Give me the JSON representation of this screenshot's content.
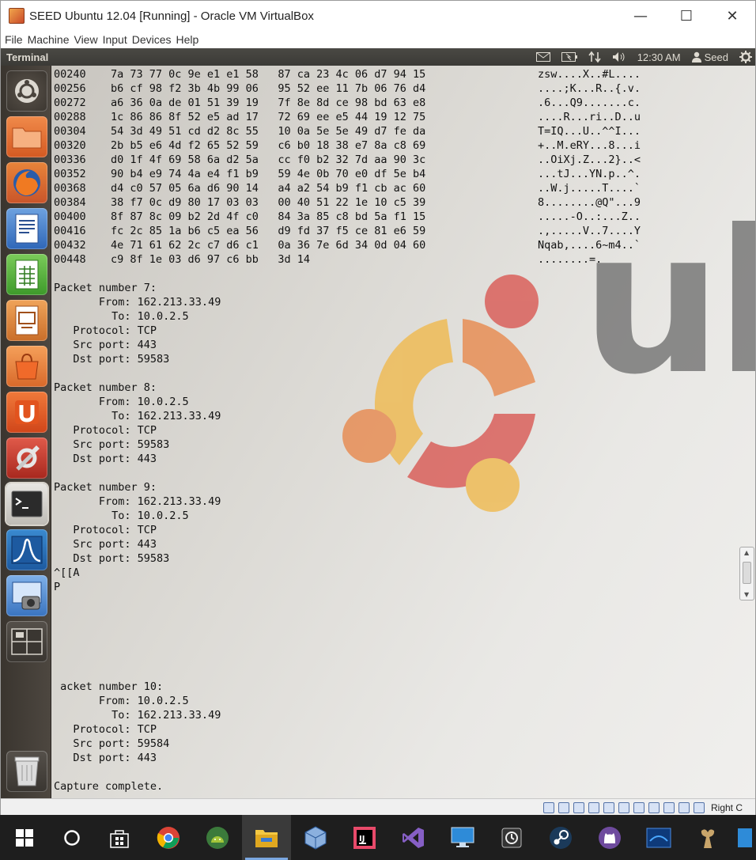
{
  "window": {
    "title": "SEED Ubuntu 12.04 [Running] - Oracle VM VirtualBox",
    "controls": {
      "minimize": "—",
      "maximize": "☐",
      "close": "✕"
    }
  },
  "menubar": {
    "items": [
      "File",
      "Machine",
      "View",
      "Input",
      "Devices",
      "Help"
    ]
  },
  "topbar": {
    "app_title": "Terminal",
    "time": "12:30 AM",
    "user": "Seed",
    "icons": [
      "mail-icon",
      "battery-icon",
      "network-icon",
      "volume-icon",
      "user-icon",
      "gear-icon"
    ]
  },
  "launcher": {
    "items": [
      "ubuntu-dash-icon",
      "files-icon",
      "firefox-icon",
      "writer-icon",
      "calc-icon",
      "impress-icon",
      "software-center-icon",
      "ubuntu-one-icon",
      "system-settings-icon",
      "terminal-icon",
      "wireshark-icon",
      "screenshot-icon",
      "workspace-switcher-icon",
      "trash-icon"
    ]
  },
  "terminal": {
    "hex_rows": [
      {
        "off": "00240",
        "hex": "7a 73 77 0c 9e e1 e1 58   87 ca 23 4c 06 d7 94 15",
        "ascii": "zsw....X..#L...."
      },
      {
        "off": "00256",
        "hex": "b6 cf 98 f2 3b 4b 99 06   95 52 ee 11 7b 06 76 d4",
        "ascii": "....;K...R..{.v."
      },
      {
        "off": "00272",
        "hex": "a6 36 0a de 01 51 39 19   7f 8e 8d ce 98 bd 63 e8",
        "ascii": ".6...Q9.......c."
      },
      {
        "off": "00288",
        "hex": "1c 86 86 8f 52 e5 ad 17   72 69 ee e5 44 19 12 75",
        "ascii": "....R...ri..D..u"
      },
      {
        "off": "00304",
        "hex": "54 3d 49 51 cd d2 8c 55   10 0a 5e 5e 49 d7 fe da",
        "ascii": "T=IQ...U..^^I..."
      },
      {
        "off": "00320",
        "hex": "2b b5 e6 4d f2 65 52 59   c6 b0 18 38 e7 8a c8 69",
        "ascii": "+..M.eRY...8...i"
      },
      {
        "off": "00336",
        "hex": "d0 1f 4f 69 58 6a d2 5a   cc f0 b2 32 7d aa 90 3c",
        "ascii": "..OiXj.Z...2}..<"
      },
      {
        "off": "00352",
        "hex": "90 b4 e9 74 4a e4 f1 b9   59 4e 0b 70 e0 df 5e b4",
        "ascii": "...tJ...YN.p..^."
      },
      {
        "off": "00368",
        "hex": "d4 c0 57 05 6a d6 90 14   a4 a2 54 b9 f1 cb ac 60",
        "ascii": "..W.j.....T....`"
      },
      {
        "off": "00384",
        "hex": "38 f7 0c d9 80 17 03 03   00 40 51 22 1e 10 c5 39",
        "ascii": "8........@Q\"...9"
      },
      {
        "off": "00400",
        "hex": "8f 87 8c 09 b2 2d 4f c0   84 3a 85 c8 bd 5a f1 15",
        "ascii": ".....-O..:...Z.."
      },
      {
        "off": "00416",
        "hex": "fc 2c 85 1a b6 c5 ea 56   d9 fd 37 f5 ce 81 e6 59",
        "ascii": ".,.....V..7....Y"
      },
      {
        "off": "00432",
        "hex": "4e 71 61 62 2c c7 d6 c1   0a 36 7e 6d 34 0d 04 60",
        "ascii": "Nqab,....6~m4..`"
      },
      {
        "off": "00448",
        "hex": "c9 8f 1e 03 d6 97 c6 bb   3d 14",
        "ascii": "........=."
      }
    ],
    "packets": [
      {
        "header": "Packet number 7:",
        "from": "       From: 162.213.33.49",
        "to": "         To: 10.0.2.5",
        "proto": "   Protocol: TCP",
        "src": "   Src port: 443",
        "dst": "   Dst port: 59583"
      },
      {
        "header": "Packet number 8:",
        "from": "       From: 10.0.2.5",
        "to": "         To: 162.213.33.49",
        "proto": "   Protocol: TCP",
        "src": "   Src port: 59583",
        "dst": "   Dst port: 443"
      },
      {
        "header": "Packet number 9:",
        "from": "       From: 162.213.33.49",
        "to": "         To: 10.0.2.5",
        "proto": "   Protocol: TCP",
        "src": "   Src port: 443",
        "dst": "   Dst port: 59583"
      }
    ],
    "escape_line": "^[[A",
    "p_line": "P",
    "packet10": {
      "header": " acket number 10:",
      "from": "       From: 10.0.2.5",
      "to": "         To: 162.213.33.49",
      "proto": "   Protocol: TCP",
      "src": "   Src port: 59584",
      "dst": "   Dst port: 443"
    },
    "footer": "Capture complete."
  },
  "wallpaper": {
    "text": "ub"
  },
  "statusbar": {
    "host_key": "Right C"
  },
  "taskbar": {
    "items": [
      "windows-start-icon",
      "cortana-icon",
      "store-icon",
      "chrome-icon",
      "android-studio-icon",
      "file-explorer-icon",
      "virtualbox-icon",
      "intellij-icon",
      "visual-studio-icon",
      "remote-desktop-icon",
      "task-app-icon",
      "steam-icon",
      "github-icon",
      "blizzard-icon",
      "game-icon",
      "app-icon"
    ]
  },
  "colors": {
    "ubuntu_orange": "#e8874a",
    "ubuntu_red": "#d95550",
    "ubuntu_yellow": "#f0b84a",
    "launcher_bg": "#3f3a34",
    "taskbar_bg": "#1e1e1e"
  }
}
